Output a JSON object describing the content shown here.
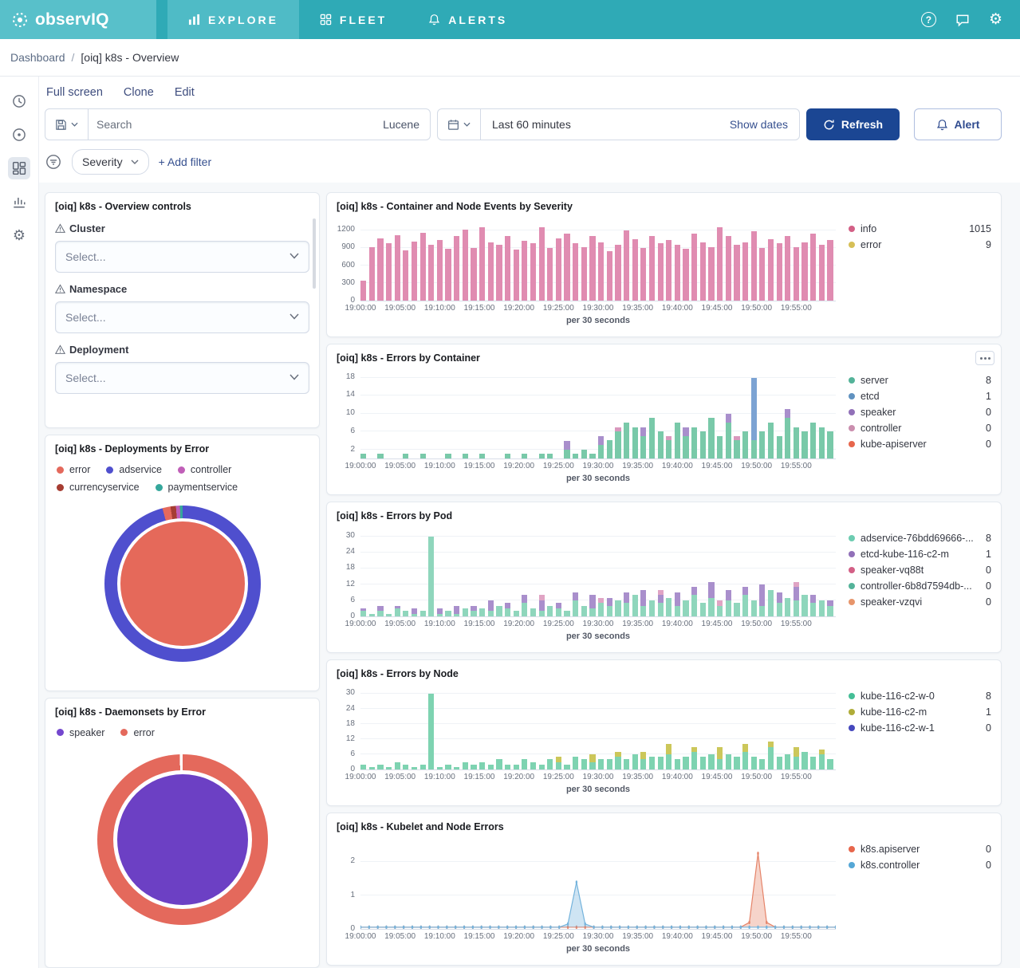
{
  "brand": {
    "name": "observIQ"
  },
  "nav": {
    "items": [
      {
        "label": "EXPLORE",
        "active": true
      },
      {
        "label": "FLEET",
        "active": false
      },
      {
        "label": "ALERTS",
        "active": false
      }
    ]
  },
  "breadcrumb": {
    "root": "Dashboard",
    "sep": "/",
    "current": "[oiq] k8s - Overview"
  },
  "menubar": {
    "full_screen": "Full screen",
    "clone": "Clone",
    "edit": "Edit"
  },
  "search": {
    "placeholder": "Search",
    "language": "Lucene"
  },
  "timebar": {
    "range": "Last 60 minutes",
    "show_dates": "Show dates",
    "refresh_label": "Refresh",
    "alert_label": "Alert"
  },
  "filterbar": {
    "severity_label": "Severity",
    "add_filter": "+ Add filter"
  },
  "controls": {
    "title": "[oiq] k8s - Overview controls",
    "items": [
      {
        "label": "Cluster",
        "placeholder": "Select..."
      },
      {
        "label": "Namespace",
        "placeholder": "Select..."
      },
      {
        "label": "Deployment",
        "placeholder": "Select..."
      }
    ]
  },
  "pies": [
    {
      "title": "[oiq] k8s - Deployments by Error",
      "legend": [
        {
          "label": "error",
          "color": "#E4695C"
        },
        {
          "label": "adservice",
          "color": "#4F4FCE"
        },
        {
          "label": "controller",
          "color": "#C05FB8"
        },
        {
          "label": "currencyservice",
          "color": "#A63D32"
        },
        {
          "label": "paymentservice",
          "color": "#35A79C"
        }
      ],
      "inner_color": "#E5695A",
      "ring": [
        {
          "color": "#4F4FCE",
          "deg": 345
        },
        {
          "color": "#E4695C",
          "deg": 6
        },
        {
          "color": "#A63D32",
          "deg": 4
        },
        {
          "color": "#C05FB8",
          "deg": 3
        },
        {
          "color": "#35A79C",
          "deg": 2
        }
      ]
    },
    {
      "title": "[oiq] k8s - Daemonsets by Error",
      "legend": [
        {
          "label": "speaker",
          "color": "#7447CE"
        },
        {
          "label": "error",
          "color": "#E4695C"
        }
      ],
      "inner_color": "#6C40C4",
      "ring": [
        {
          "color": "#E4695C",
          "deg": 358
        },
        {
          "color": "#FFFFFF",
          "deg": 2
        }
      ]
    }
  ],
  "charts": {
    "x_ticks": [
      "19:00:00",
      "19:05:00",
      "19:10:00",
      "19:15:00",
      "19:20:00",
      "19:25:00",
      "19:30:00",
      "19:35:00",
      "19:40:00",
      "19:45:00",
      "19:50:00",
      "19:55:00"
    ],
    "x_label": "per 30 seconds",
    "severity": {
      "title": "[oiq] k8s - Container and Node Events by Severity",
      "type": "bar",
      "y_ticks": [
        0,
        300,
        600,
        900,
        1200
      ],
      "y_max": 1350,
      "series": [
        {
          "name": "info",
          "color": "#E08CB1",
          "values": [
            340,
            920,
            1060,
            980,
            1120,
            860,
            1010,
            1160,
            950,
            1030,
            880,
            1100,
            1210,
            900,
            1255,
            1000,
            950,
            1110,
            870,
            1020,
            980,
            1250,
            900,
            1060,
            1150,
            980,
            920,
            1100,
            1000,
            850,
            950,
            1200,
            1050,
            900,
            1110,
            980,
            1030,
            950,
            880,
            1150,
            1000,
            920,
            1255,
            1100,
            950,
            1000,
            1180,
            900,
            1050,
            980,
            1110,
            920,
            1000,
            1150,
            950,
            1030
          ]
        }
      ],
      "legend": [
        {
          "label": "info",
          "color": "#D36086",
          "value": "1015"
        },
        {
          "label": "error",
          "color": "#D6BF57",
          "value": "9"
        }
      ]
    },
    "container": {
      "title": "[oiq] k8s - Errors by Container",
      "type": "bar",
      "y_ticks": [
        2,
        6,
        10,
        14,
        18
      ],
      "y_max": 19,
      "series": [
        {
          "name": "server",
          "color": "#79C9A9",
          "values": [
            1,
            0,
            1,
            0,
            0,
            1,
            0,
            1,
            0,
            0,
            1,
            0,
            1,
            0,
            1,
            0,
            0,
            1,
            0,
            1,
            0,
            1,
            1,
            0,
            2,
            1,
            2,
            1,
            3,
            4,
            6,
            8,
            7,
            5,
            9,
            6,
            4,
            8,
            5,
            7,
            6,
            9,
            5,
            8,
            4,
            6,
            4,
            6,
            8,
            5,
            9,
            7,
            6,
            8,
            7,
            6
          ]
        },
        {
          "name": "etcd",
          "color": "#7CA3D3",
          "values": [
            0,
            0,
            0,
            0,
            0,
            0,
            0,
            0,
            0,
            0,
            0,
            0,
            0,
            0,
            0,
            0,
            0,
            0,
            0,
            0,
            0,
            0,
            0,
            0,
            0,
            0,
            0,
            0,
            0,
            0,
            0,
            0,
            0,
            0,
            0,
            0,
            0,
            0,
            0,
            0,
            0,
            0,
            0,
            0,
            0,
            0,
            14,
            0,
            0,
            0,
            0,
            0,
            0,
            0,
            0,
            0
          ]
        },
        {
          "name": "speaker",
          "color": "#A98FCC",
          "values": [
            0,
            0,
            0,
            0,
            0,
            0,
            0,
            0,
            0,
            0,
            0,
            0,
            0,
            0,
            0,
            0,
            0,
            0,
            0,
            0,
            0,
            0,
            0,
            0,
            2,
            0,
            0,
            0,
            2,
            0,
            0,
            0,
            0,
            2,
            0,
            0,
            0,
            0,
            2,
            0,
            0,
            0,
            0,
            2,
            0,
            0,
            0,
            0,
            0,
            0,
            2,
            0,
            0,
            0,
            0,
            0
          ]
        },
        {
          "name": "controller",
          "color": "#D998BD",
          "values": [
            0,
            0,
            0,
            0,
            0,
            0,
            0,
            0,
            0,
            0,
            0,
            0,
            0,
            0,
            0,
            0,
            0,
            0,
            0,
            0,
            0,
            0,
            0,
            0,
            0,
            0,
            0,
            0,
            0,
            0,
            1,
            0,
            0,
            0,
            0,
            0,
            1,
            0,
            0,
            0,
            0,
            0,
            0,
            0,
            1,
            0,
            0,
            0,
            0,
            0,
            0,
            0,
            0,
            0,
            0,
            0
          ]
        }
      ],
      "legend": [
        {
          "label": "server",
          "color": "#54B399",
          "value": "8"
        },
        {
          "label": "etcd",
          "color": "#6092C0",
          "value": "1"
        },
        {
          "label": "speaker",
          "color": "#9170B8",
          "value": "0"
        },
        {
          "label": "controller",
          "color": "#CA8EAE",
          "value": "0"
        },
        {
          "label": "kube-apiserver",
          "color": "#E7664C",
          "value": "0"
        }
      ]
    },
    "pod": {
      "title": "[oiq] k8s - Errors by Pod",
      "type": "bar",
      "y_ticks": [
        0,
        6,
        12,
        18,
        24,
        30
      ],
      "y_max": 32,
      "series": [
        {
          "name": "adservice",
          "color": "#8FD6BC",
          "values": [
            2,
            1,
            2,
            1,
            3,
            2,
            1,
            2,
            30,
            1,
            2,
            1,
            3,
            2,
            3,
            2,
            4,
            3,
            2,
            5,
            3,
            2,
            4,
            3,
            2,
            6,
            4,
            3,
            5,
            4,
            6,
            5,
            8,
            4,
            6,
            5,
            7,
            4,
            6,
            8,
            5,
            7,
            4,
            6,
            5,
            8,
            6,
            4,
            10,
            5,
            7,
            6,
            8,
            5,
            6,
            4
          ]
        },
        {
          "name": "etcd",
          "color": "#A98FCC",
          "values": [
            1,
            0,
            2,
            0,
            1,
            0,
            2,
            0,
            0,
            2,
            0,
            3,
            0,
            2,
            0,
            4,
            0,
            2,
            0,
            3,
            0,
            4,
            0,
            2,
            0,
            3,
            0,
            5,
            0,
            3,
            0,
            4,
            0,
            6,
            0,
            3,
            0,
            5,
            0,
            3,
            0,
            6,
            0,
            4,
            0,
            3,
            0,
            8,
            0,
            4,
            0,
            5,
            0,
            3,
            0,
            2
          ]
        },
        {
          "name": "speaker",
          "color": "#E0A4C4",
          "values": [
            0,
            0,
            0,
            0,
            0,
            0,
            0,
            0,
            0,
            0,
            0,
            0,
            0,
            0,
            0,
            0,
            0,
            0,
            0,
            0,
            0,
            2,
            0,
            0,
            0,
            0,
            0,
            0,
            2,
            0,
            0,
            0,
            0,
            0,
            0,
            2,
            0,
            0,
            0,
            0,
            0,
            0,
            2,
            0,
            0,
            0,
            0,
            0,
            0,
            0,
            0,
            2,
            0,
            0,
            0,
            0
          ]
        }
      ],
      "legend": [
        {
          "label": "adservice-76bdd69666-...",
          "color": "#6DCCB1",
          "value": "8"
        },
        {
          "label": "etcd-kube-116-c2-m",
          "color": "#9170B8",
          "value": "1"
        },
        {
          "label": "speaker-vq88t",
          "color": "#D36086",
          "value": "0"
        },
        {
          "label": "controller-6b8d7594db-...",
          "color": "#54B399",
          "value": "0"
        },
        {
          "label": "speaker-vzqvi",
          "color": "#E7956B",
          "value": "0"
        }
      ]
    },
    "node": {
      "title": "[oiq] k8s - Errors by Node",
      "type": "bar",
      "y_ticks": [
        0,
        6,
        12,
        18,
        24,
        30
      ],
      "y_max": 32,
      "series": [
        {
          "name": "kube-116-c2-w-0",
          "color": "#7ED3B1",
          "values": [
            2,
            1,
            2,
            1,
            3,
            2,
            1,
            2,
            30,
            1,
            2,
            1,
            3,
            2,
            3,
            2,
            4,
            2,
            2,
            4,
            3,
            2,
            4,
            3,
            2,
            5,
            4,
            3,
            4,
            4,
            5,
            4,
            6,
            4,
            5,
            5,
            6,
            4,
            5,
            7,
            5,
            6,
            4,
            6,
            5,
            7,
            5,
            4,
            9,
            5,
            6,
            5,
            7,
            5,
            6,
            4
          ]
        },
        {
          "name": "kube-116-c2-m",
          "color": "#CCC75A",
          "values": [
            0,
            0,
            0,
            0,
            0,
            0,
            0,
            0,
            0,
            0,
            0,
            0,
            0,
            0,
            0,
            0,
            0,
            0,
            0,
            0,
            0,
            0,
            0,
            2,
            0,
            0,
            0,
            3,
            0,
            0,
            2,
            0,
            0,
            3,
            0,
            0,
            4,
            0,
            0,
            2,
            0,
            0,
            5,
            0,
            0,
            3,
            0,
            0,
            2,
            0,
            0,
            4,
            0,
            0,
            2,
            0
          ]
        }
      ],
      "legend": [
        {
          "label": "kube-116-c2-w-0",
          "color": "#45BE96",
          "value": "8"
        },
        {
          "label": "kube-116-c2-m",
          "color": "#AFAC38",
          "value": "1"
        },
        {
          "label": "kube-116-c2-w-1",
          "color": "#4548BD",
          "value": "0"
        }
      ]
    },
    "kubelet": {
      "title": "[oiq] k8s - Kubelet and Node Errors",
      "type": "line",
      "y_ticks": [
        0,
        1,
        2
      ],
      "y_max": 2.6,
      "series": [
        {
          "name": "k8s.apiserver",
          "color": "#E58368",
          "fill": "rgba(229,131,104,0.35)",
          "values": [
            0,
            0,
            0,
            0,
            0,
            0,
            0,
            0,
            0,
            0,
            0,
            0,
            0,
            0,
            0,
            0,
            0,
            0,
            0,
            0,
            0,
            0,
            0,
            0,
            0,
            0,
            0,
            0,
            0,
            0,
            0,
            0,
            0,
            0,
            0,
            0,
            0,
            0,
            0,
            0,
            0,
            0,
            0,
            0,
            0,
            0.15,
            2.3,
            0.15,
            0,
            0,
            0,
            0,
            0,
            0,
            0,
            0
          ]
        },
        {
          "name": "k8s.controller",
          "color": "#74B3DC",
          "fill": "rgba(116,179,220,0.35)",
          "values": [
            0,
            0,
            0,
            0,
            0,
            0,
            0,
            0,
            0,
            0,
            0,
            0,
            0,
            0,
            0,
            0,
            0,
            0,
            0,
            0,
            0,
            0,
            0,
            0,
            0.1,
            1.4,
            0.1,
            0,
            0,
            0,
            0,
            0,
            0,
            0,
            0,
            0,
            0,
            0,
            0,
            0,
            0,
            0,
            0,
            0,
            0,
            0,
            0,
            0,
            0,
            0,
            0,
            0,
            0,
            0,
            0,
            0
          ]
        }
      ],
      "legend": [
        {
          "label": "k8s.apiserver",
          "color": "#E7664C",
          "value": "0"
        },
        {
          "label": "k8s.controller",
          "color": "#55A7D6",
          "value": "0"
        }
      ]
    }
  }
}
